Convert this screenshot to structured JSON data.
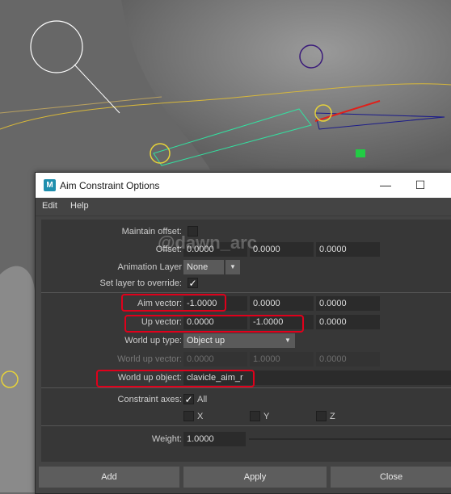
{
  "watermark": "@dawn_arc",
  "window": {
    "title": "Aim Constraint Options",
    "app_icon_letter": "M",
    "minimize_glyph": "—",
    "maximize_glyph": "☐"
  },
  "menu": [
    "Edit",
    "Help"
  ],
  "options": {
    "maintain_offset_label": "Maintain offset:",
    "offset_label": "Offset:",
    "offset_values": [
      "0.0000",
      "0.0000",
      "0.0000"
    ],
    "animation_layer_label": "Animation Layer",
    "animation_layer_value": "None",
    "set_layer_label": "Set layer to override:",
    "aim_vector_label": "Aim vector:",
    "aim_vector_values": [
      "-1.0000",
      "0.0000",
      "0.0000"
    ],
    "up_vector_label": "Up vector:",
    "up_vector_values": [
      "0.0000",
      "-1.0000",
      "0.0000"
    ],
    "world_up_type_label": "World up type:",
    "world_up_type_value": "Object up",
    "world_up_vector_label": "World up vector:",
    "world_up_vector_values": [
      "0.0000",
      "1.0000",
      "0.0000"
    ],
    "world_up_object_label": "World up object:",
    "world_up_object_value": "clavicle_aim_r",
    "constraint_axes_label": "Constraint axes:",
    "axis_all_label": "All",
    "axis_x_label": "X",
    "axis_y_label": "Y",
    "axis_z_label": "Z",
    "weight_label": "Weight:",
    "weight_value": "1.0000"
  },
  "buttons": {
    "add": "Add",
    "apply": "Apply",
    "close": "Close"
  },
  "icons": {
    "check": "✓",
    "dropdown": "▼"
  },
  "colors": {
    "highlight": "#e0001b",
    "panel": "#373737"
  }
}
